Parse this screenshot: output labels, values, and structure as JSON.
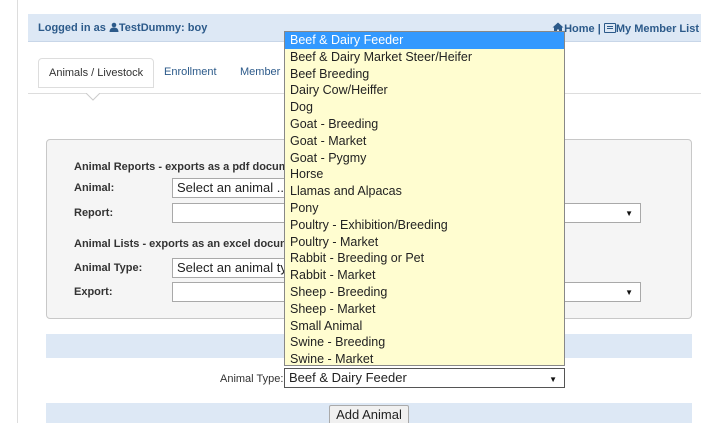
{
  "header": {
    "logged_in_prefix": "Logged in as",
    "user": "TestDummy: boy",
    "home_label": "Home",
    "separator": "|",
    "member_list_label": "My Member List"
  },
  "tabs": [
    "Animals / Livestock",
    "Enrollment",
    "Member"
  ],
  "reports": {
    "section_title": "Animal Reports - exports as a pdf documen",
    "animal_label": "Animal:",
    "animal_value": "Select an animal ...",
    "report_label": "Report:",
    "report_value": ""
  },
  "lists": {
    "section_title": "Animal Lists - exports as an excel documen",
    "animal_type_label": "Animal Type:",
    "animal_type_value": "Select an animal ty",
    "export_label": "Export:",
    "export_value": ""
  },
  "add_form": {
    "animal_type_label": "Animal Type:",
    "selected": "Beef & Dairy Feeder",
    "button_label": "Add Animal"
  },
  "dropdown_options": [
    "Beef & Dairy Feeder",
    "Beef & Dairy Market Steer/Heifer",
    "Beef Breeding",
    "Dairy Cow/Heiffer",
    "Dog",
    "Goat - Breeding",
    "Goat - Market",
    "Goat - Pygmy",
    "Horse",
    "Llamas and Alpacas",
    "Pony",
    "Poultry - Exhibition/Breeding",
    "Poultry - Market",
    "Rabbit - Breeding or Pet",
    "Rabbit - Market",
    "Sheep - Breeding",
    "Sheep - Market",
    "Small Animal",
    "Swine - Breeding",
    "Swine - Market"
  ],
  "dropdown_selected_index": 0,
  "colors": {
    "header_bg": "#dde8f5",
    "link": "#2c5a8a",
    "dropdown_bg": "#fffdd0",
    "highlight": "#3399ff"
  }
}
